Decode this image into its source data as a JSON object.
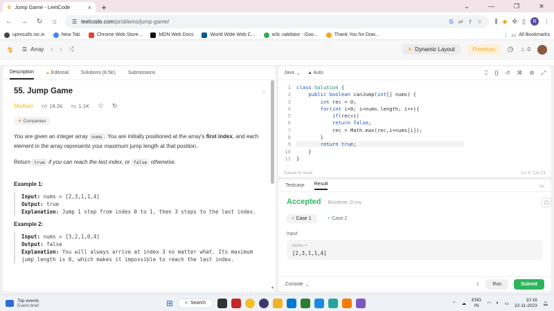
{
  "browser": {
    "tab_title": "Jump Game - LeetCode",
    "url_host": "leetcode.com",
    "url_path": "/problems/jump-game/",
    "bookmarks": [
      {
        "label": "upresults.nic.in",
        "color": "#444"
      },
      {
        "label": "New Tab",
        "color": "#4285f4"
      },
      {
        "label": "Chrome Web Store...",
        "color": "#e94235"
      },
      {
        "label": "MDN Web Docs",
        "color": "#111"
      },
      {
        "label": "World Wide Web C...",
        "color": "#005a9c"
      },
      {
        "label": "w3c validator - Goo...",
        "color": "#34a853"
      },
      {
        "label": "Thank You for Dow...",
        "color": "#f5a623"
      }
    ],
    "all_bookmarks": "All Bookmarks",
    "profile_initial": "R"
  },
  "lc_header": {
    "problem_list": "Array",
    "dynamic_layout": "Dynamic Layout",
    "premium": "Premium",
    "streak_count": "0"
  },
  "left": {
    "tabs": [
      "Description",
      "Editorial",
      "Solutions (8.5K)",
      "Submissions"
    ],
    "title": "55. Jump Game",
    "difficulty": "Medium",
    "likes": "18.2K",
    "dislikes": "1.1K",
    "companies": "Companies",
    "desc_1a": "You are given an integer array ",
    "desc_1_code": "nums",
    "desc_1b": ". You are initially positioned at the array's ",
    "desc_1_bold": "first index",
    "desc_1c": ", and each element in the array represents your maximum jump length at that position.",
    "desc_2a": "Return ",
    "desc_2_code1": "true",
    "desc_2b": " if you can reach the last index",
    "desc_2c": ", or ",
    "desc_2_code2": "false",
    "desc_2d": " otherwise",
    "desc_2e": ".",
    "examples": [
      {
        "title": "Example 1:",
        "input_label": "Input:",
        "input": " nums = [2,3,1,1,4]",
        "output_label": "Output:",
        "output": " true",
        "expl_label": "Explanation:",
        "expl": " Jump 1 step from index 0 to 1, then 3 steps to the last index."
      },
      {
        "title": "Example 2:",
        "input_label": "Input:",
        "input": " nums = [3,2,1,0,4]",
        "output_label": "Output:",
        "output": " false",
        "expl_label": "Explanation:",
        "expl": " You will always arrive at index 3 no matter what. Its maximum jump length is 0, which makes it impossible to reach the last index."
      }
    ]
  },
  "editor": {
    "language": "Java",
    "mode": "Auto",
    "saved": "Saved to local",
    "cursor": "Ln 9, Col 21"
  },
  "console": {
    "tabs": [
      "Testcase",
      "Result"
    ],
    "status": "Accepted",
    "runtime": "Runtime: 0 ms",
    "cases": [
      "Case 1",
      "Case 2"
    ],
    "input_label": "Input",
    "input_key": "nums =",
    "input_value": "[2,3,1,1,4]",
    "console_label": "Console",
    "run": "Run",
    "submit": "Submit"
  },
  "taskbar": {
    "news_title": "Top events",
    "news_sub": "Event brief",
    "search": "Search",
    "lang_1": "ENG",
    "lang_2": "IN",
    "time": "10:16",
    "date": "22-11-2023"
  }
}
